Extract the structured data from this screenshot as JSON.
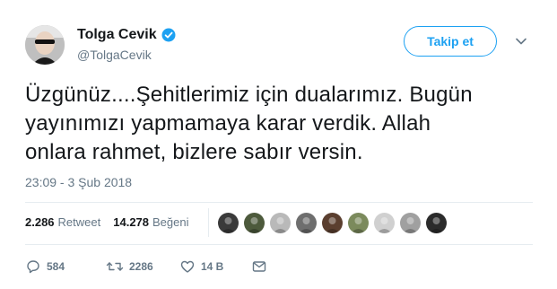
{
  "author": {
    "display_name": "Tolga Cevik",
    "handle": "@TolgaCevik",
    "verified": true,
    "avatar_icon": "profile-photo"
  },
  "follow_button": {
    "label": "Takip et"
  },
  "menu": {
    "icon": "chevron-down-icon"
  },
  "tweet": {
    "text": "Üzgünüz....Şehitlerimiz için dualarımız. Bugün\nyayınımızı yapmamaya karar verdik. Allah\nonlara rahmet, bizlere sabır versin.",
    "timestamp": "23:09 - 3 Şub 2018"
  },
  "stats": {
    "retweets_count": "2.286",
    "retweets_label": "Retweet",
    "likes_count": "14.278",
    "likes_label": "Beğeni"
  },
  "likers": [
    {
      "icon": "liker-avatar",
      "color": "#3a3a3a"
    },
    {
      "icon": "liker-avatar",
      "color": "#4d5a3c"
    },
    {
      "icon": "liker-avatar",
      "color": "#b9b9b9"
    },
    {
      "icon": "liker-avatar",
      "color": "#6e6e6e"
    },
    {
      "icon": "liker-avatar",
      "color": "#5b3f2f"
    },
    {
      "icon": "liker-avatar",
      "color": "#7b8a5c"
    },
    {
      "icon": "liker-avatar",
      "color": "#d0d0d0"
    },
    {
      "icon": "liker-avatar",
      "color": "#a0a0a0"
    },
    {
      "icon": "liker-avatar",
      "color": "#2b2b2b"
    }
  ],
  "actions": {
    "reply_count": "584",
    "retweet_count": "2286",
    "like_count": "14 B"
  },
  "colors": {
    "accent": "#1da1f2",
    "muted": "#657786",
    "text": "#14171a",
    "retweet_green": "#17bf63"
  }
}
